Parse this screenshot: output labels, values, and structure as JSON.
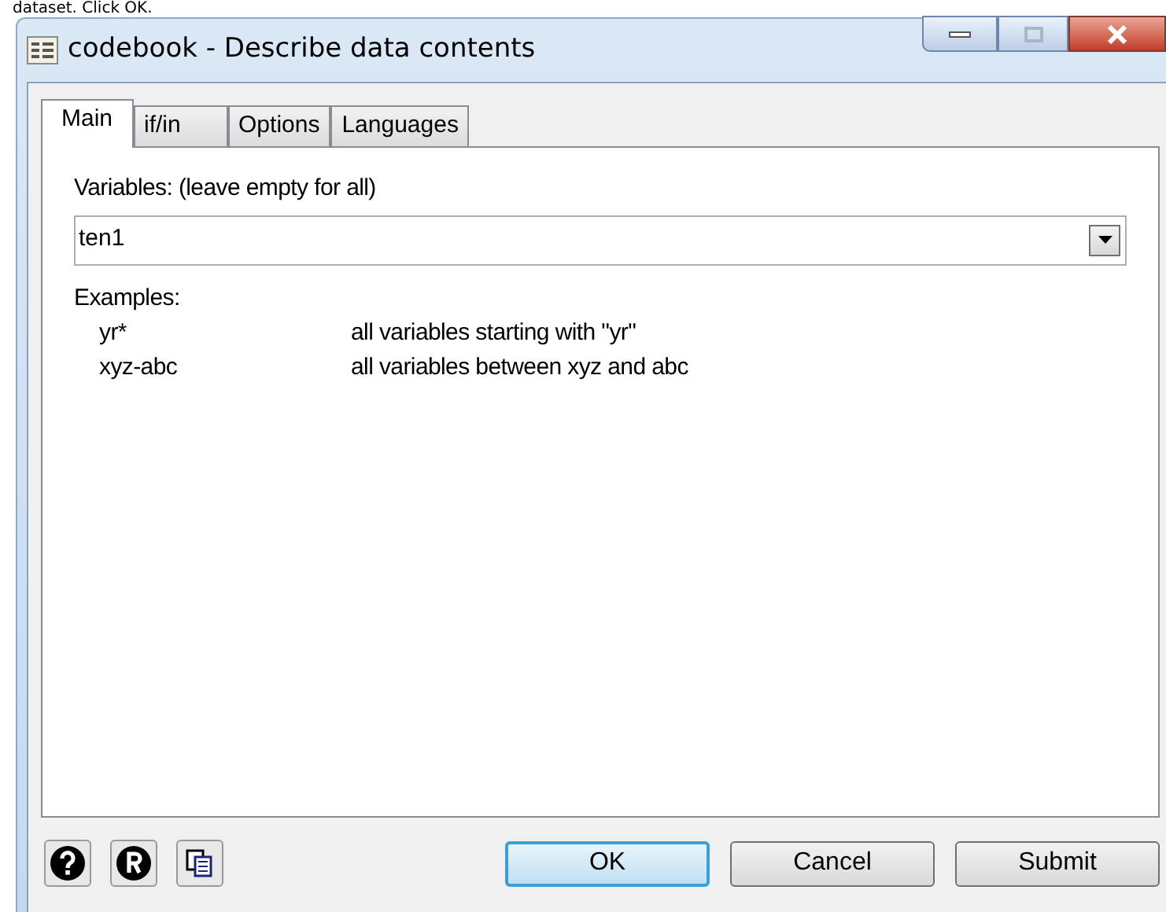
{
  "caption": "dataset. Click OK.",
  "window": {
    "title": "codebook - Describe data contents"
  },
  "tabs": [
    {
      "label": "Main",
      "selected": true
    },
    {
      "label": "if/in",
      "selected": false
    },
    {
      "label": "Options",
      "selected": false
    },
    {
      "label": "Languages",
      "selected": false
    }
  ],
  "variables": {
    "label": "Variables: (leave empty for all)",
    "value": "ten1"
  },
  "examples": {
    "heading": "Examples:",
    "rows": [
      {
        "pattern": "yr*",
        "description": "all variables starting with \"yr\""
      },
      {
        "pattern": "xyz-abc",
        "description": "all variables between xyz and abc"
      }
    ]
  },
  "buttons": [
    {
      "label": "OK",
      "default": true
    },
    {
      "label": "Cancel",
      "default": false
    },
    {
      "label": "Submit",
      "default": false
    }
  ]
}
